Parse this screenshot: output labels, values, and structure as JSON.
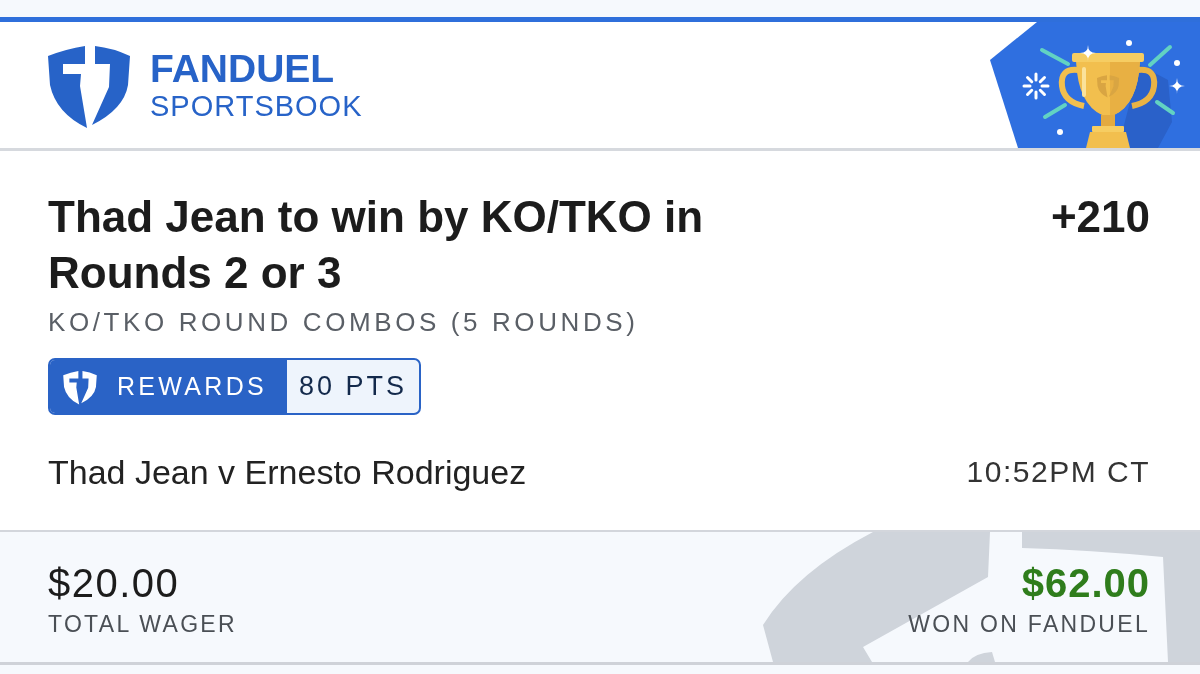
{
  "header": {
    "brand": "FANDUEL",
    "subbrand": "SPORTSBOOK"
  },
  "bet": {
    "selection": "Thad Jean to win by KO/TKO in Rounds 2 or 3",
    "odds": "+210",
    "market": "KO/TKO ROUND COMBOS (5 ROUNDS)",
    "rewards": {
      "label": "REWARDS",
      "points": "80 PTS"
    },
    "event": "Thad Jean v Ernesto Rodriguez",
    "time": "10:52PM CT"
  },
  "footer": {
    "wager": {
      "amount": "$20.00",
      "label": "TOTAL WAGER"
    },
    "payout": {
      "amount": "$62.00",
      "label": "WON ON FANDUEL",
      "won": true
    }
  }
}
